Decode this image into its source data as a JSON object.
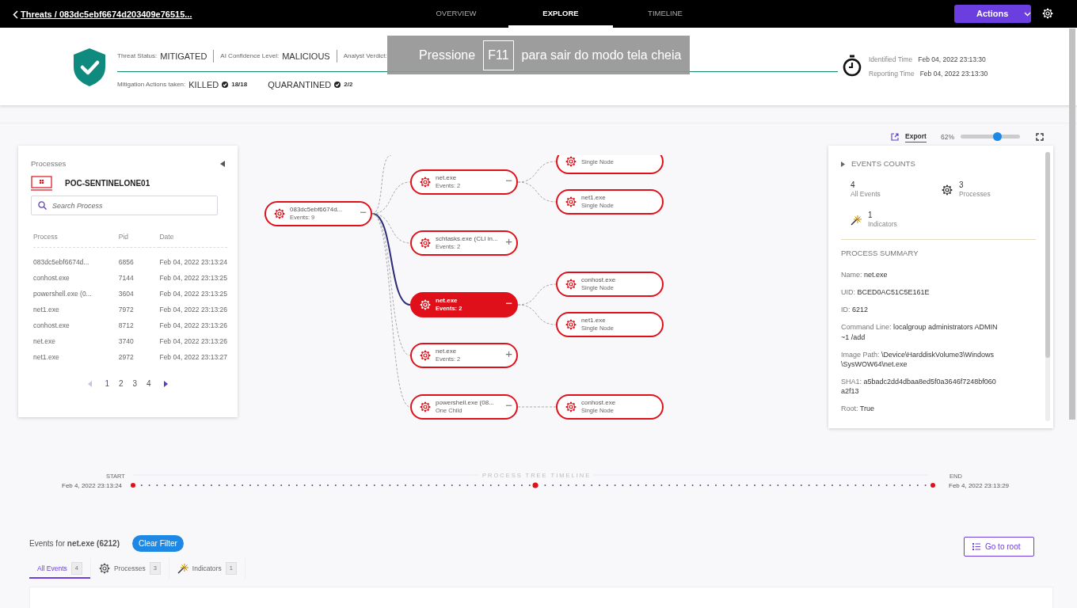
{
  "topbar": {
    "breadcrumb": "Threats / 083dc5ebf6674d203409e76515...",
    "tabs": [
      {
        "label": "OVERVIEW",
        "selected": false
      },
      {
        "label": "EXPLORE",
        "selected": true
      },
      {
        "label": "TIMELINE",
        "selected": false
      }
    ],
    "actions_button": "Actions"
  },
  "threat": {
    "status_label": "Threat Status:",
    "status": "MITIGATED",
    "confidence_label": "AI Confidence Level:",
    "confidence": "MALICIOUS",
    "verdict_label": "Analyst Verdict:",
    "mitigation_label": "Mitigation Actions taken:",
    "mitigations": [
      {
        "action": "KILLED",
        "count": "18/18"
      },
      {
        "action": "QUARANTINED",
        "count": "2/2"
      }
    ],
    "times": [
      {
        "label": "Identified Time",
        "value": "Feb 04, 2022 23:13:30"
      },
      {
        "label": "Reporting Time",
        "value": "Feb 04, 2022 23:13:30"
      }
    ]
  },
  "fullscreen_notice": {
    "before": "Pressione",
    "key": "F11",
    "after": "para sair do modo tela cheia"
  },
  "processes_panel": {
    "title": "Processes",
    "endpoint": "POC-SENTINELONE01",
    "search": {
      "placeholder": "Search Process"
    },
    "columns": [
      "Process",
      "Pid",
      "Date"
    ],
    "rows": [
      [
        "083dc5ebf6674d...",
        "6856",
        "Feb 04, 2022 23:13:24"
      ],
      [
        "conhost.exe",
        "7144",
        "Feb 04, 2022 23:13:25"
      ],
      [
        "powershell.exe (0...",
        "3604",
        "Feb 04, 2022 23:13:25"
      ],
      [
        "net1.exe",
        "7972",
        "Feb 04, 2022 23:13:26"
      ],
      [
        "conhost.exe",
        "8712",
        "Feb 04, 2022 23:13:26"
      ],
      [
        "net.exe",
        "3740",
        "Feb 04, 2022 23:13:26"
      ],
      [
        "net1.exe",
        "2972",
        "Feb 04, 2022 23:13:27"
      ]
    ],
    "pages": [
      {
        "label": "1",
        "selected": true
      },
      {
        "label": "2",
        "selected": false
      },
      {
        "label": "3",
        "selected": false
      },
      {
        "label": "4",
        "selected": false
      }
    ]
  },
  "toolbar": {
    "export": "Export",
    "zoom": "62%",
    "level": 0.62
  },
  "process_tree": {
    "name": "083dc5ebf6674d...",
    "subtitle": "Events: 9",
    "toggle": "−",
    "selected": false,
    "children": [
      {
        "name": "net.exe",
        "subtitle": "Events: 2",
        "toggle": "−",
        "selected": false,
        "children": [
          {
            "subtitle": "Single Node",
            "selected": false
          },
          {
            "name": "net1.exe",
            "subtitle": "Single Node",
            "selected": false
          }
        ]
      },
      {
        "name": "schtasks.exe (CLI in...",
        "subtitle": "Events: 2",
        "toggle": "+",
        "selected": false
      },
      {
        "name": "net.exe",
        "subtitle": "Events: 2",
        "toggle": "−",
        "selected": true,
        "children": [
          {
            "name": "conhost.exe",
            "subtitle": "Single Node",
            "selected": false
          },
          {
            "name": "net1.exe",
            "subtitle": "Single Node",
            "selected": false
          }
        ]
      },
      {
        "name": "net.exe",
        "subtitle": "Events: 2",
        "toggle": "+",
        "selected": false
      },
      {
        "name": "powershell.exe (08...",
        "subtitle": "One Child",
        "toggle": "−",
        "selected": false,
        "children": [
          {
            "name": "conhost.exe",
            "subtitle": "Single Node",
            "selected": false
          }
        ]
      }
    ]
  },
  "events_counts": {
    "title": "EVENTS COUNTS",
    "items": [
      {
        "kind": "all",
        "count": "4",
        "label": "All Events"
      },
      {
        "kind": "processes",
        "count": "3",
        "label": "Processes"
      },
      {
        "kind": "indicators",
        "count": "1",
        "label": "Indicators"
      }
    ]
  },
  "process_summary": {
    "title": "PROCESS SUMMARY",
    "fields": [
      {
        "label": "Name:",
        "value": "net.exe"
      },
      {
        "label": "UID:",
        "value": "BCED0AC51C5E161E"
      },
      {
        "label": "ID:",
        "value": "6212"
      },
      {
        "label": "Command Line:",
        "value": "localgroup administrators ADMIN~1 /add"
      },
      {
        "label": "Image Path:",
        "value": "\\Device\\HarddiskVolume3\\Windows\\SysWOW64\\net.exe"
      },
      {
        "label": "SHA1:",
        "value": "a5badc2dd4dbaa8ed5f0a3646f7248bf060a2f13"
      },
      {
        "label": "Root:",
        "value": "True"
      }
    ]
  },
  "timeline": {
    "title": "PROCESS TREE TIMELINE",
    "start_label": "START",
    "start": "Feb 4, 2022 23:13:24",
    "end_label": "END",
    "end": "Feb 4, 2022 23:13:29"
  },
  "events": {
    "title": "Events for **net.exe (6212)**",
    "clear_filter": "Clear Filter",
    "go_to_root": "Go to root",
    "tabs": [
      {
        "kind": "all",
        "label": "All Events",
        "count": "4",
        "selected": true
      },
      {
        "kind": "processes",
        "label": "Processes",
        "count": "3",
        "selected": false
      },
      {
        "kind": "indicators",
        "label": "Indicators",
        "count": "1",
        "selected": false
      }
    ]
  }
}
